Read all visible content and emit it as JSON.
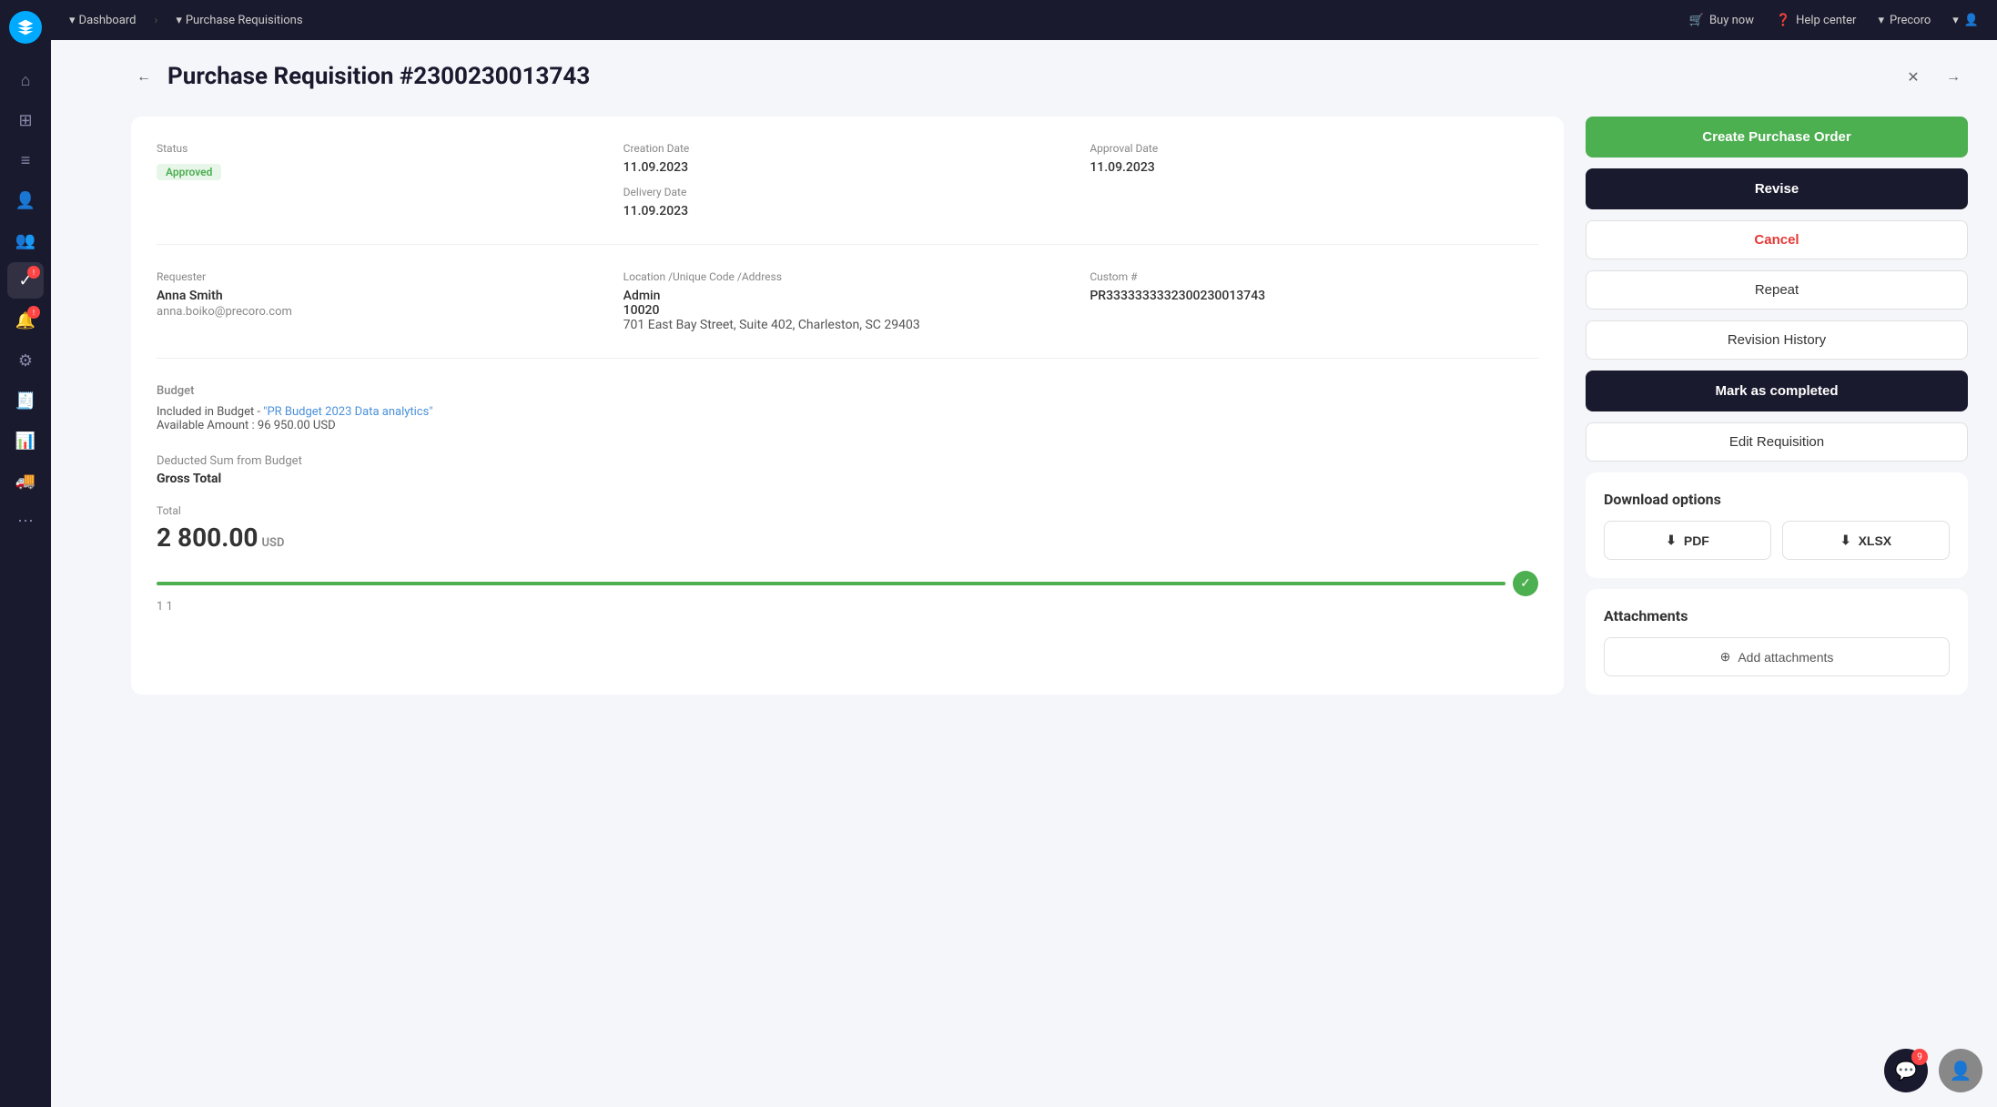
{
  "topnav": {
    "items": [
      "Dashboard",
      "Purchase Requisitions"
    ],
    "right": {
      "buy_now": "Buy now",
      "help_center": "Help center",
      "company": "Precoro"
    }
  },
  "page": {
    "title": "Purchase Requisition #2300230013743",
    "back_label": "←",
    "close_label": "×",
    "next_label": "→"
  },
  "status": {
    "label": "Status",
    "value": "Approved"
  },
  "creation_date": {
    "label": "Creation Date",
    "value": "11.09.2023"
  },
  "approval_date": {
    "label": "Approval Date",
    "value": "11.09.2023"
  },
  "delivery_date": {
    "label": "Delivery Date",
    "value": "11.09.2023"
  },
  "requester": {
    "label": "Requester",
    "name": "Anna Smith",
    "email": "anna.boiko@precoro.com"
  },
  "location": {
    "label": "Location /Unique Code /Address",
    "name": "Admin",
    "code": "10020",
    "address": "701 East Bay Street, Suite 402, Charleston, SC 29403"
  },
  "custom": {
    "label": "Custom #",
    "value": "PR3333333332300230013743"
  },
  "budget": {
    "label": "Budget",
    "included_prefix": "Included in Budget - ",
    "budget_link": "\"PR Budget 2023 Data analytics\"",
    "available": "Available Amount : 96 950.00 USD"
  },
  "deducted": {
    "label": "Deducted Sum from Budget",
    "gross_label": "Gross Total"
  },
  "total": {
    "label": "Total",
    "value": "2 800.00",
    "currency": "USD"
  },
  "progress": {
    "step": "1 1"
  },
  "actions": {
    "create_po": "Create Purchase Order",
    "revise": "Revise",
    "cancel": "Cancel",
    "repeat": "Repeat",
    "revision_history": "Revision History",
    "mark_completed": "Mark as completed",
    "edit_requisition": "Edit Requisition"
  },
  "download": {
    "title": "Download options",
    "pdf": "PDF",
    "xlsx": "XLSX"
  },
  "attachments": {
    "title": "Attachments",
    "add_label": "Add attachments"
  },
  "chat_badge": "9",
  "sidebar_icons": [
    {
      "name": "home-icon",
      "icon": "⌂"
    },
    {
      "name": "dashboard-icon",
      "icon": "⊞"
    },
    {
      "name": "orders-icon",
      "icon": "≡"
    },
    {
      "name": "users-icon",
      "icon": "👤"
    },
    {
      "name": "team-icon",
      "icon": "👥"
    },
    {
      "name": "tasks-icon",
      "icon": "✓",
      "badge": true
    },
    {
      "name": "reports-icon",
      "icon": "📊"
    },
    {
      "name": "settings-icon",
      "icon": "⚙"
    },
    {
      "name": "invoices-icon",
      "icon": "🧾"
    },
    {
      "name": "analytics-icon",
      "icon": "📈"
    },
    {
      "name": "delivery-icon",
      "icon": "🚚"
    },
    {
      "name": "more-icon",
      "icon": "⋮"
    }
  ]
}
